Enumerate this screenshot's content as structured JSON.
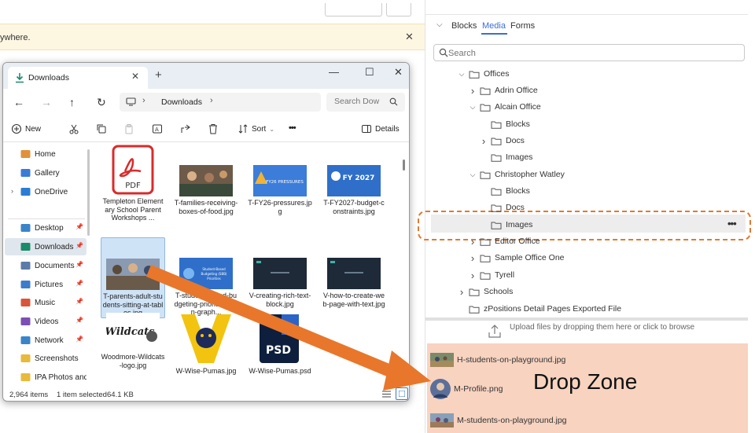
{
  "background": {
    "banner_text": "ywhere.",
    "banner_close": "✕"
  },
  "panel": {
    "tabs": {
      "blocks": "Blocks",
      "media": "Media",
      "forms": "Forms"
    },
    "search_placeholder": "Search",
    "tree": [
      {
        "label": "Offices",
        "chevron": "down"
      },
      {
        "label": "Adrin Office",
        "chevron": "right"
      },
      {
        "label": "Alcain Office",
        "chevron": "down"
      },
      {
        "label": "Blocks",
        "chevron": "none"
      },
      {
        "label": "Docs",
        "chevron": "right"
      },
      {
        "label": "Images",
        "chevron": "none"
      },
      {
        "label": "Christopher Watley",
        "chevron": "down"
      },
      {
        "label": "Blocks",
        "chevron": "none"
      },
      {
        "label": "Docs",
        "chevron": "none"
      },
      {
        "label": "Images",
        "chevron": "none"
      },
      {
        "label": "Editor Office",
        "chevron": "right"
      },
      {
        "label": "Sample Office One",
        "chevron": "right"
      },
      {
        "label": "Tyrell",
        "chevron": "right"
      },
      {
        "label": "Schools",
        "chevron": "right"
      },
      {
        "label": "zPositions Detail Pages Exported File",
        "chevron": "none"
      }
    ],
    "more_menu": "•••",
    "upload_text": "Upload files by dropping them here or click to browse",
    "dropzone": {
      "label": "Drop Zone",
      "files": [
        "H-students-on-playground.jpg",
        "M-Profile.png",
        "M-students-on-playground.jpg"
      ]
    }
  },
  "explorer": {
    "tab_title": "Downloads",
    "address": "Downloads",
    "search_placeholder": "Search Dow",
    "toolbar": {
      "new": "New",
      "sort": "Sort",
      "more": "•••",
      "details": "Details"
    },
    "sidebar": [
      {
        "label": "Home",
        "icon": "home-icon",
        "pinned": false
      },
      {
        "label": "Gallery",
        "icon": "gallery-icon",
        "pinned": false
      },
      {
        "label": "OneDrive",
        "icon": "cloud-icon",
        "pinned": false
      },
      {
        "label": "Desktop",
        "icon": "desktop-icon",
        "pinned": true
      },
      {
        "label": "Downloads",
        "icon": "download-icon",
        "pinned": true
      },
      {
        "label": "Documents",
        "icon": "document-icon",
        "pinned": true
      },
      {
        "label": "Pictures",
        "icon": "pictures-icon",
        "pinned": true
      },
      {
        "label": "Music",
        "icon": "music-icon",
        "pinned": true
      },
      {
        "label": "Videos",
        "icon": "videos-icon",
        "pinned": true
      },
      {
        "label": "Network",
        "icon": "network-icon",
        "pinned": true
      },
      {
        "label": "Screenshots",
        "icon": "folder-icon",
        "pinned": false
      },
      {
        "label": "IPA Photos and T",
        "icon": "folder-icon",
        "pinned": false
      }
    ],
    "files": [
      {
        "name": "Templeton Elementary School Parent Workshops ...",
        "thumb": "pdf"
      },
      {
        "name": "T-families-receiving-boxes-of-food.jpg",
        "thumb": "photo"
      },
      {
        "name": "T-FY26-pressures.jpg",
        "thumb": "fy26",
        "thumb_text": "FY26 PRESSURES"
      },
      {
        "name": "T-FY2027-budget-constraints.jpg",
        "thumb": "fy27",
        "thumb_text": "FY 2027"
      },
      {
        "name": "T-parents-adult-students-sitting-at-tables.jpg",
        "thumb": "photo2",
        "selected": true
      },
      {
        "name": "T-student-based-budgeting-priorities-sign-graph...",
        "thumb": "sbb",
        "thumb_text": "Student-Based Budgeting (SBB) Priorities"
      },
      {
        "name": "V-creating-rich-text-block.jpg",
        "thumb": "dark"
      },
      {
        "name": "V-how-to-create-web-page-with-text.jpg",
        "thumb": "dark"
      },
      {
        "name": "Woodmore-Wildcats-logo.jpg",
        "thumb": "wildcats",
        "thumb_text": "Wildcats"
      },
      {
        "name": "W-Wise-Pumas.jpg",
        "thumb": "pumas"
      },
      {
        "name": "W-Wise-Pumas.psd",
        "thumb": "psd",
        "thumb_text": "PSD"
      }
    ],
    "status": {
      "count": "2,964 items",
      "selected": "1 item selected",
      "size": "64.1 KB"
    }
  },
  "colors": {
    "accent": "#3b6fd4",
    "dropzone": "#f7d3c0",
    "arrow": "#e8772b",
    "dashed": "#e07a30"
  }
}
